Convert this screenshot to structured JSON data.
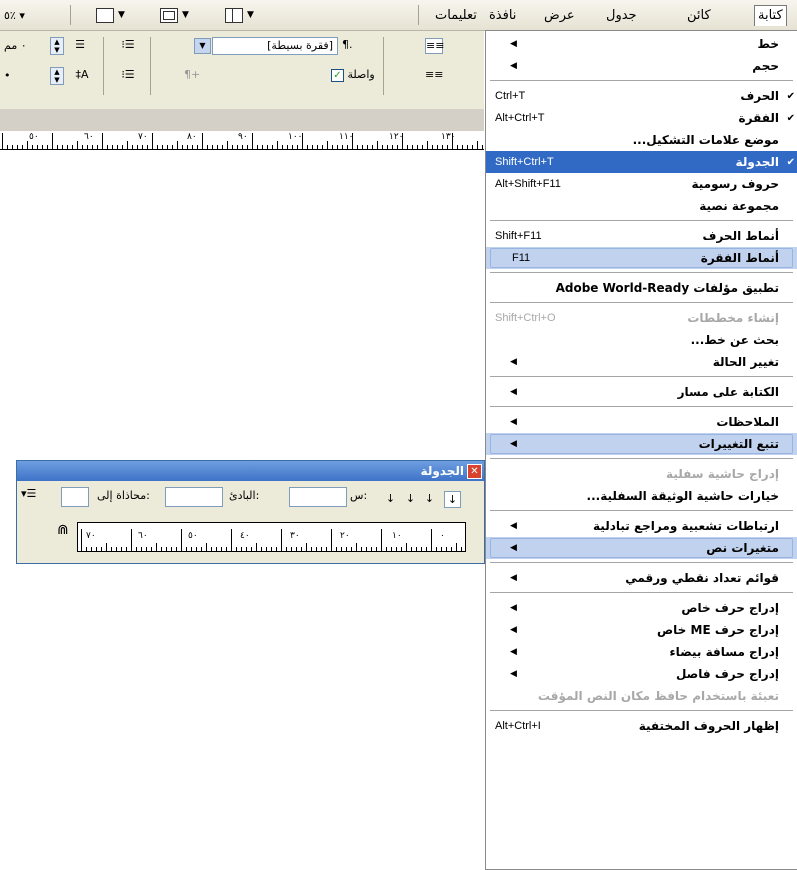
{
  "menubar": {
    "items": [
      "كتابة",
      "كائن",
      "جدول",
      "عرض",
      "نافذة",
      "تعليمات"
    ],
    "zoom_label": "٥٪ ▾"
  },
  "control": {
    "style_value": "[فقرة بسيطة]",
    "hyphenate_label": "واصلة",
    "size_value": "٠ مم"
  },
  "ruler": {
    "labels": [
      "٥٠",
      "٦٠",
      "٧٠",
      "٨٠",
      "٩٠",
      "١٠٠",
      "١١٠",
      "١٢٠",
      "١٣٠"
    ]
  },
  "tabs_panel": {
    "title": "الجدولة",
    "x_label": "س:",
    "leader_label": "البادئ:",
    "align_on_label": "محاذاة إلى:",
    "ruler_labels": [
      "٧٠",
      "٦٠",
      "٥٠",
      "٤٠",
      "٣٠",
      "٢٠",
      "١٠",
      "٠"
    ]
  },
  "menu": {
    "items": [
      {
        "label": "خط",
        "arrow": true
      },
      {
        "label": "حجم",
        "arrow": true
      },
      {
        "sep": true
      },
      {
        "label": "الحرف",
        "shortcut": "Ctrl+T",
        "check": true
      },
      {
        "label": "الفقرة",
        "shortcut": "Alt+Ctrl+T",
        "check": true
      },
      {
        "label": "موضع علامات التشكيل...",
        "check": false
      },
      {
        "label": "الجدولة",
        "shortcut": "Shift+Ctrl+T",
        "check": true,
        "selected": true
      },
      {
        "label": "حروف رسومية",
        "shortcut": "Alt+Shift+F11"
      },
      {
        "label": "مجموعة نصية"
      },
      {
        "sep": true
      },
      {
        "label": "أنماط الحرف",
        "shortcut": "Shift+F11"
      },
      {
        "label": "أنماط الفقرة",
        "shortcut": "F11",
        "hl": true
      },
      {
        "sep": true
      },
      {
        "label": "تطبيق مؤلفات Adobe World-Ready"
      },
      {
        "sep": true
      },
      {
        "label": "إنشاء مخططات",
        "shortcut": "Shift+Ctrl+O",
        "disabled": true
      },
      {
        "label": "بحث عن خط...",
        "normal": false
      },
      {
        "label": "تغيير الحالة",
        "arrow": true
      },
      {
        "sep": true
      },
      {
        "label": "الكتابة على مسار",
        "arrow": true
      },
      {
        "sep": true
      },
      {
        "label": "الملاحظات",
        "arrow": true
      },
      {
        "label": "تتبع التغييرات",
        "arrow": true,
        "hl": true
      },
      {
        "sep": true
      },
      {
        "label": "إدراج حاشية سفلية",
        "disabled": true
      },
      {
        "label": "خيارات حاشية الوثيقة السفلية..."
      },
      {
        "sep": true
      },
      {
        "label": "ارتباطات تشعبية ومراجع تبادلية",
        "arrow": true
      },
      {
        "label": "متغيرات نص",
        "arrow": true,
        "hl": true
      },
      {
        "sep": true
      },
      {
        "label": "قوائم تعداد نقطي ورقمي",
        "arrow": true
      },
      {
        "sep": true
      },
      {
        "label": "إدراج حرف خاص",
        "arrow": true
      },
      {
        "label": "إدراج حرف ME خاص",
        "arrow": true
      },
      {
        "label": "إدراج مسافة بيضاء",
        "arrow": true
      },
      {
        "label": "إدراج حرف فاصل",
        "arrow": true
      },
      {
        "label": "تعبئة باستخدام حافظ مكان النص المؤقت",
        "disabled": true
      },
      {
        "sep": true
      },
      {
        "label": "إظهار الحروف المختفية",
        "shortcut": "Alt+Ctrl+I"
      }
    ]
  }
}
